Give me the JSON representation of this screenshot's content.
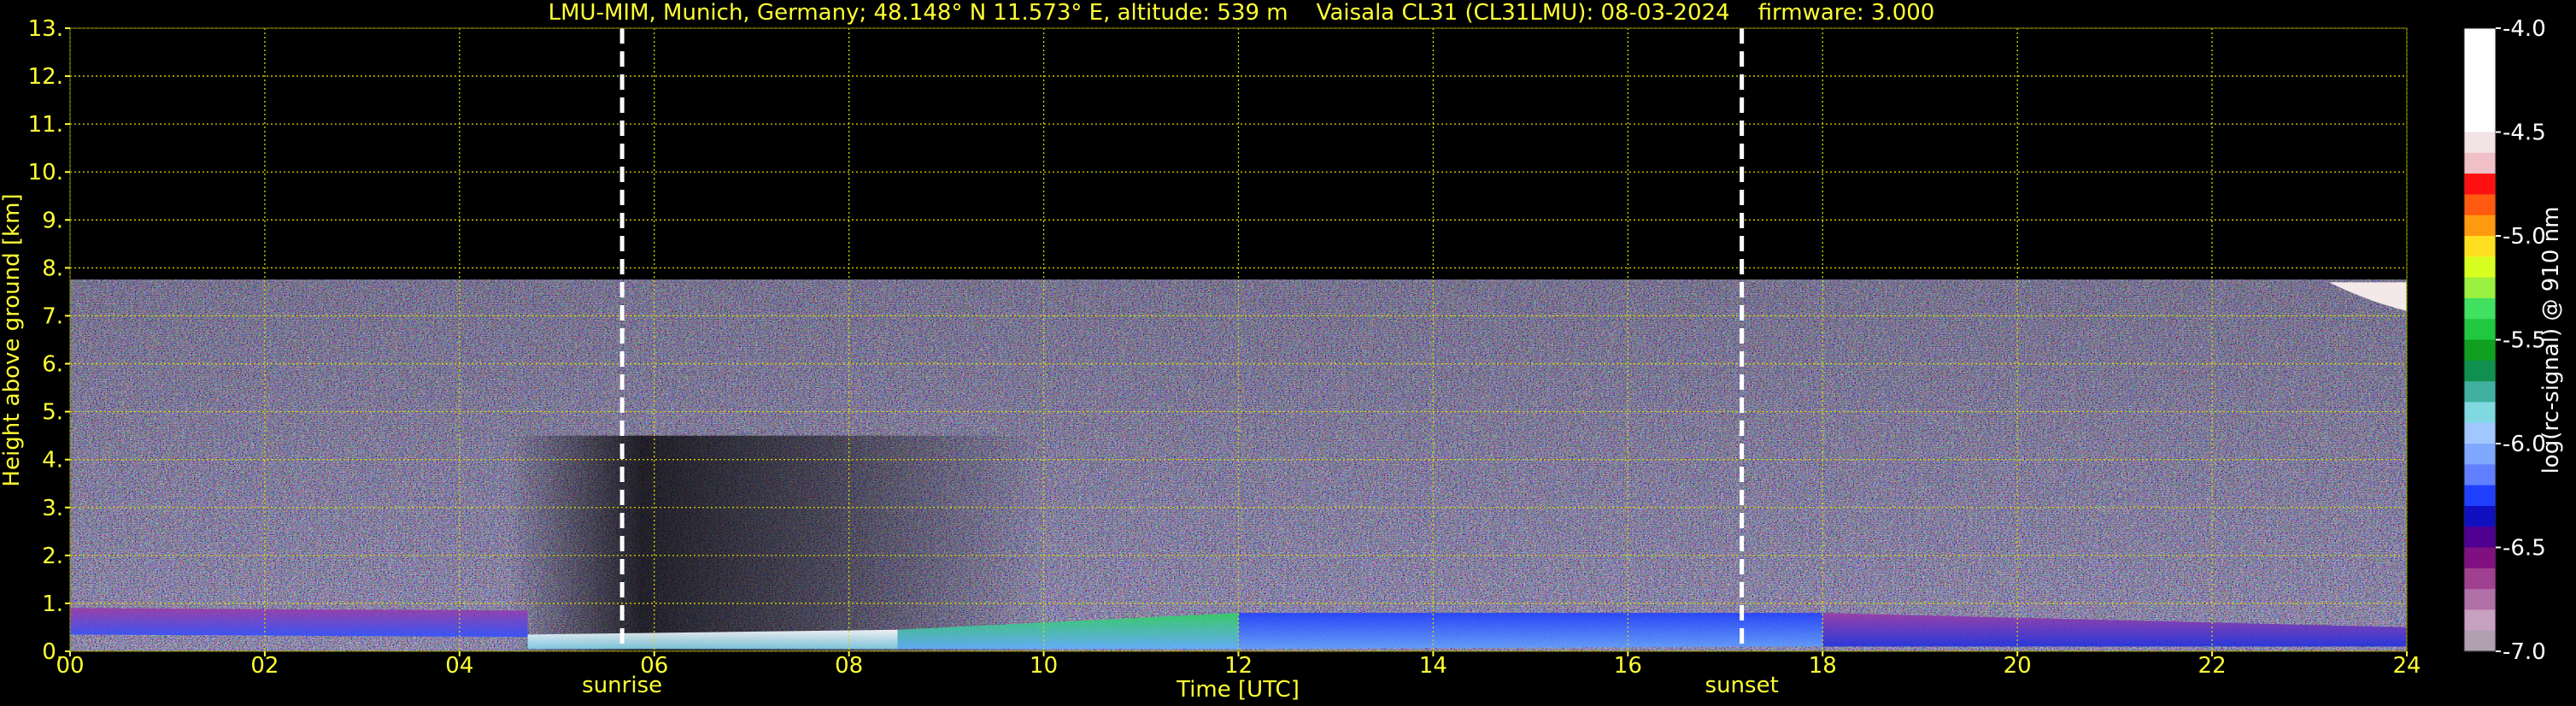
{
  "chart_data": {
    "type": "heatmap",
    "title": "LMU-MIM, Munich, Germany; 48.148° N 11.573° E, altitude: 539 m    Vaisala CL31 (CL31LMU): 08-03-2024    firmware: 3.000",
    "xlabel": "Time [UTC]",
    "ylabel": "Height above ground [km]",
    "xlim": [
      0,
      24
    ],
    "ylim": [
      0,
      13
    ],
    "x_ticks": [
      0,
      2,
      4,
      6,
      8,
      10,
      12,
      14,
      16,
      18,
      20,
      22,
      24
    ],
    "x_tick_labels": [
      "00",
      "02",
      "04",
      "06",
      "08",
      "10",
      "12",
      "14",
      "16",
      "18",
      "20",
      "22",
      "24"
    ],
    "y_ticks": [
      0,
      1,
      2,
      3,
      4,
      5,
      6,
      7,
      8,
      9,
      10,
      11,
      12,
      13
    ],
    "y_tick_labels": [
      "0.",
      "1.",
      "2.",
      "3.",
      "4.",
      "5.",
      "6.",
      "7.",
      "8.",
      "9.",
      "10.",
      "11.",
      "12.",
      "13."
    ],
    "grid": true,
    "grid_color": "#d8d800",
    "text_color": "#ffff33",
    "background_color": "#000000",
    "max_data_height_km": 7.75,
    "events": [
      {
        "label": "sunrise",
        "time": 5.67
      },
      {
        "label": "sunset",
        "time": 17.17
      }
    ],
    "colorbar": {
      "label": "log(rc-signal) @ 910 nm",
      "range": [
        -7.0,
        -4.0
      ],
      "ticks": [
        -4.0,
        -4.5,
        -5.0,
        -5.5,
        -6.0,
        -6.5,
        -7.0
      ],
      "tick_labels": [
        "-4.0",
        "-4.5",
        "-5.0",
        "-5.5",
        "-6.0",
        "-6.5",
        "-7.0"
      ],
      "colors": [
        "#ffffff",
        "#ffffff",
        "#ffffff",
        "#ffffff",
        "#ffffff",
        "#f3e2e6",
        "#efc0c6",
        "#ff1010",
        "#ff5a10",
        "#ff9a10",
        "#ffe020",
        "#d8ff20",
        "#9af040",
        "#40e060",
        "#20c840",
        "#10a020",
        "#109050",
        "#40b0a0",
        "#80d8e0",
        "#a0c8ff",
        "#80a8ff",
        "#6080ff",
        "#2040ff",
        "#1010c0",
        "#500090",
        "#801080",
        "#a04090",
        "#b070a8",
        "#c8a0c0",
        "#b0a0b0"
      ]
    },
    "boundary_layer": [
      {
        "time": 0,
        "top_km": 0.9,
        "base_km": 0.35,
        "top_color": "#9a3aa8",
        "base_color": "#3050ff"
      },
      {
        "time": 4.7,
        "top_km": 0.85,
        "base_km": 0.3,
        "top_color": "#9a3aa8",
        "base_color": "#2040e0"
      },
      {
        "time": 4.7,
        "top_km": 0.35,
        "base_km": 0.05,
        "top_color": "#ffffff",
        "base_color": "#80d0e8"
      },
      {
        "time": 8.5,
        "top_km": 0.45,
        "base_km": 0.05,
        "top_color": "#30d060",
        "base_color": "#60b0ff"
      },
      {
        "time": 12.0,
        "top_km": 0.8,
        "base_km": 0.05,
        "top_color": "#2040ff",
        "base_color": "#60a0ff"
      },
      {
        "time": 18.0,
        "top_km": 0.8,
        "base_km": 0.1,
        "top_color": "#9a3aa8",
        "base_color": "#2030e0"
      },
      {
        "time": 24.0,
        "top_km": 0.5,
        "base_km": 0.1,
        "top_color": "#c04070",
        "base_color": "#1020d0"
      }
    ]
  }
}
